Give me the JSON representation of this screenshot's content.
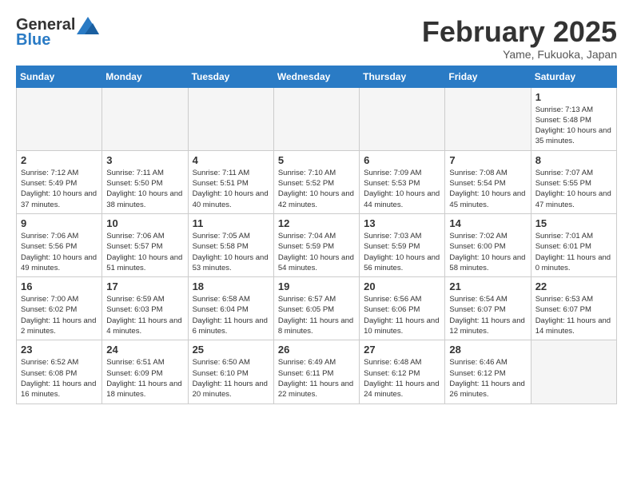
{
  "header": {
    "logo_text_general": "General",
    "logo_text_blue": "Blue",
    "calendar_title": "February 2025",
    "calendar_subtitle": "Yame, Fukuoka, Japan"
  },
  "weekdays": [
    "Sunday",
    "Monday",
    "Tuesday",
    "Wednesday",
    "Thursday",
    "Friday",
    "Saturday"
  ],
  "weeks": [
    [
      {
        "day": "",
        "empty": true
      },
      {
        "day": "",
        "empty": true
      },
      {
        "day": "",
        "empty": true
      },
      {
        "day": "",
        "empty": true
      },
      {
        "day": "",
        "empty": true
      },
      {
        "day": "",
        "empty": true
      },
      {
        "day": "1",
        "sunrise": "7:13 AM",
        "sunset": "5:48 PM",
        "daylight": "10 hours and 35 minutes."
      }
    ],
    [
      {
        "day": "2",
        "sunrise": "7:12 AM",
        "sunset": "5:49 PM",
        "daylight": "10 hours and 37 minutes."
      },
      {
        "day": "3",
        "sunrise": "7:11 AM",
        "sunset": "5:50 PM",
        "daylight": "10 hours and 38 minutes."
      },
      {
        "day": "4",
        "sunrise": "7:11 AM",
        "sunset": "5:51 PM",
        "daylight": "10 hours and 40 minutes."
      },
      {
        "day": "5",
        "sunrise": "7:10 AM",
        "sunset": "5:52 PM",
        "daylight": "10 hours and 42 minutes."
      },
      {
        "day": "6",
        "sunrise": "7:09 AM",
        "sunset": "5:53 PM",
        "daylight": "10 hours and 44 minutes."
      },
      {
        "day": "7",
        "sunrise": "7:08 AM",
        "sunset": "5:54 PM",
        "daylight": "10 hours and 45 minutes."
      },
      {
        "day": "8",
        "sunrise": "7:07 AM",
        "sunset": "5:55 PM",
        "daylight": "10 hours and 47 minutes."
      }
    ],
    [
      {
        "day": "9",
        "sunrise": "7:06 AM",
        "sunset": "5:56 PM",
        "daylight": "10 hours and 49 minutes."
      },
      {
        "day": "10",
        "sunrise": "7:06 AM",
        "sunset": "5:57 PM",
        "daylight": "10 hours and 51 minutes."
      },
      {
        "day": "11",
        "sunrise": "7:05 AM",
        "sunset": "5:58 PM",
        "daylight": "10 hours and 53 minutes."
      },
      {
        "day": "12",
        "sunrise": "7:04 AM",
        "sunset": "5:59 PM",
        "daylight": "10 hours and 54 minutes."
      },
      {
        "day": "13",
        "sunrise": "7:03 AM",
        "sunset": "5:59 PM",
        "daylight": "10 hours and 56 minutes."
      },
      {
        "day": "14",
        "sunrise": "7:02 AM",
        "sunset": "6:00 PM",
        "daylight": "10 hours and 58 minutes."
      },
      {
        "day": "15",
        "sunrise": "7:01 AM",
        "sunset": "6:01 PM",
        "daylight": "11 hours and 0 minutes."
      }
    ],
    [
      {
        "day": "16",
        "sunrise": "7:00 AM",
        "sunset": "6:02 PM",
        "daylight": "11 hours and 2 minutes."
      },
      {
        "day": "17",
        "sunrise": "6:59 AM",
        "sunset": "6:03 PM",
        "daylight": "11 hours and 4 minutes."
      },
      {
        "day": "18",
        "sunrise": "6:58 AM",
        "sunset": "6:04 PM",
        "daylight": "11 hours and 6 minutes."
      },
      {
        "day": "19",
        "sunrise": "6:57 AM",
        "sunset": "6:05 PM",
        "daylight": "11 hours and 8 minutes."
      },
      {
        "day": "20",
        "sunrise": "6:56 AM",
        "sunset": "6:06 PM",
        "daylight": "11 hours and 10 minutes."
      },
      {
        "day": "21",
        "sunrise": "6:54 AM",
        "sunset": "6:07 PM",
        "daylight": "11 hours and 12 minutes."
      },
      {
        "day": "22",
        "sunrise": "6:53 AM",
        "sunset": "6:07 PM",
        "daylight": "11 hours and 14 minutes."
      }
    ],
    [
      {
        "day": "23",
        "sunrise": "6:52 AM",
        "sunset": "6:08 PM",
        "daylight": "11 hours and 16 minutes."
      },
      {
        "day": "24",
        "sunrise": "6:51 AM",
        "sunset": "6:09 PM",
        "daylight": "11 hours and 18 minutes."
      },
      {
        "day": "25",
        "sunrise": "6:50 AM",
        "sunset": "6:10 PM",
        "daylight": "11 hours and 20 minutes."
      },
      {
        "day": "26",
        "sunrise": "6:49 AM",
        "sunset": "6:11 PM",
        "daylight": "11 hours and 22 minutes."
      },
      {
        "day": "27",
        "sunrise": "6:48 AM",
        "sunset": "6:12 PM",
        "daylight": "11 hours and 24 minutes."
      },
      {
        "day": "28",
        "sunrise": "6:46 AM",
        "sunset": "6:12 PM",
        "daylight": "11 hours and 26 minutes."
      },
      {
        "day": "",
        "empty": true
      }
    ]
  ]
}
